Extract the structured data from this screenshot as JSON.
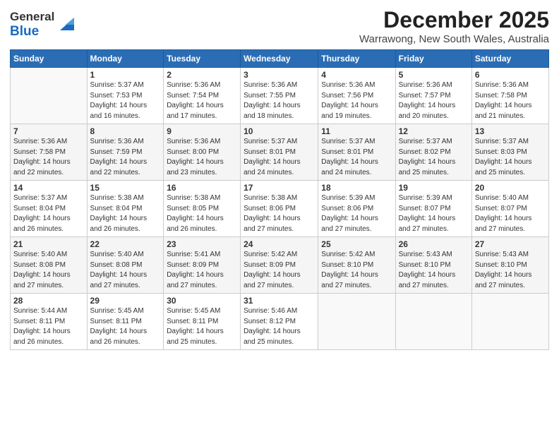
{
  "header": {
    "logo_general": "General",
    "logo_blue": "Blue",
    "month": "December 2025",
    "location": "Warrawong, New South Wales, Australia"
  },
  "weekdays": [
    "Sunday",
    "Monday",
    "Tuesday",
    "Wednesday",
    "Thursday",
    "Friday",
    "Saturday"
  ],
  "weeks": [
    [
      {
        "day": "",
        "sunrise": "",
        "sunset": "",
        "daylight": ""
      },
      {
        "day": "1",
        "sunrise": "Sunrise: 5:37 AM",
        "sunset": "Sunset: 7:53 PM",
        "daylight": "Daylight: 14 hours and 16 minutes."
      },
      {
        "day": "2",
        "sunrise": "Sunrise: 5:36 AM",
        "sunset": "Sunset: 7:54 PM",
        "daylight": "Daylight: 14 hours and 17 minutes."
      },
      {
        "day": "3",
        "sunrise": "Sunrise: 5:36 AM",
        "sunset": "Sunset: 7:55 PM",
        "daylight": "Daylight: 14 hours and 18 minutes."
      },
      {
        "day": "4",
        "sunrise": "Sunrise: 5:36 AM",
        "sunset": "Sunset: 7:56 PM",
        "daylight": "Daylight: 14 hours and 19 minutes."
      },
      {
        "day": "5",
        "sunrise": "Sunrise: 5:36 AM",
        "sunset": "Sunset: 7:57 PM",
        "daylight": "Daylight: 14 hours and 20 minutes."
      },
      {
        "day": "6",
        "sunrise": "Sunrise: 5:36 AM",
        "sunset": "Sunset: 7:58 PM",
        "daylight": "Daylight: 14 hours and 21 minutes."
      }
    ],
    [
      {
        "day": "7",
        "sunrise": "Sunrise: 5:36 AM",
        "sunset": "Sunset: 7:58 PM",
        "daylight": "Daylight: 14 hours and 22 minutes."
      },
      {
        "day": "8",
        "sunrise": "Sunrise: 5:36 AM",
        "sunset": "Sunset: 7:59 PM",
        "daylight": "Daylight: 14 hours and 22 minutes."
      },
      {
        "day": "9",
        "sunrise": "Sunrise: 5:36 AM",
        "sunset": "Sunset: 8:00 PM",
        "daylight": "Daylight: 14 hours and 23 minutes."
      },
      {
        "day": "10",
        "sunrise": "Sunrise: 5:37 AM",
        "sunset": "Sunset: 8:01 PM",
        "daylight": "Daylight: 14 hours and 24 minutes."
      },
      {
        "day": "11",
        "sunrise": "Sunrise: 5:37 AM",
        "sunset": "Sunset: 8:01 PM",
        "daylight": "Daylight: 14 hours and 24 minutes."
      },
      {
        "day": "12",
        "sunrise": "Sunrise: 5:37 AM",
        "sunset": "Sunset: 8:02 PM",
        "daylight": "Daylight: 14 hours and 25 minutes."
      },
      {
        "day": "13",
        "sunrise": "Sunrise: 5:37 AM",
        "sunset": "Sunset: 8:03 PM",
        "daylight": "Daylight: 14 hours and 25 minutes."
      }
    ],
    [
      {
        "day": "14",
        "sunrise": "Sunrise: 5:37 AM",
        "sunset": "Sunset: 8:04 PM",
        "daylight": "Daylight: 14 hours and 26 minutes."
      },
      {
        "day": "15",
        "sunrise": "Sunrise: 5:38 AM",
        "sunset": "Sunset: 8:04 PM",
        "daylight": "Daylight: 14 hours and 26 minutes."
      },
      {
        "day": "16",
        "sunrise": "Sunrise: 5:38 AM",
        "sunset": "Sunset: 8:05 PM",
        "daylight": "Daylight: 14 hours and 26 minutes."
      },
      {
        "day": "17",
        "sunrise": "Sunrise: 5:38 AM",
        "sunset": "Sunset: 8:06 PM",
        "daylight": "Daylight: 14 hours and 27 minutes."
      },
      {
        "day": "18",
        "sunrise": "Sunrise: 5:39 AM",
        "sunset": "Sunset: 8:06 PM",
        "daylight": "Daylight: 14 hours and 27 minutes."
      },
      {
        "day": "19",
        "sunrise": "Sunrise: 5:39 AM",
        "sunset": "Sunset: 8:07 PM",
        "daylight": "Daylight: 14 hours and 27 minutes."
      },
      {
        "day": "20",
        "sunrise": "Sunrise: 5:40 AM",
        "sunset": "Sunset: 8:07 PM",
        "daylight": "Daylight: 14 hours and 27 minutes."
      }
    ],
    [
      {
        "day": "21",
        "sunrise": "Sunrise: 5:40 AM",
        "sunset": "Sunset: 8:08 PM",
        "daylight": "Daylight: 14 hours and 27 minutes."
      },
      {
        "day": "22",
        "sunrise": "Sunrise: 5:40 AM",
        "sunset": "Sunset: 8:08 PM",
        "daylight": "Daylight: 14 hours and 27 minutes."
      },
      {
        "day": "23",
        "sunrise": "Sunrise: 5:41 AM",
        "sunset": "Sunset: 8:09 PM",
        "daylight": "Daylight: 14 hours and 27 minutes."
      },
      {
        "day": "24",
        "sunrise": "Sunrise: 5:42 AM",
        "sunset": "Sunset: 8:09 PM",
        "daylight": "Daylight: 14 hours and 27 minutes."
      },
      {
        "day": "25",
        "sunrise": "Sunrise: 5:42 AM",
        "sunset": "Sunset: 8:10 PM",
        "daylight": "Daylight: 14 hours and 27 minutes."
      },
      {
        "day": "26",
        "sunrise": "Sunrise: 5:43 AM",
        "sunset": "Sunset: 8:10 PM",
        "daylight": "Daylight: 14 hours and 27 minutes."
      },
      {
        "day": "27",
        "sunrise": "Sunrise: 5:43 AM",
        "sunset": "Sunset: 8:10 PM",
        "daylight": "Daylight: 14 hours and 27 minutes."
      }
    ],
    [
      {
        "day": "28",
        "sunrise": "Sunrise: 5:44 AM",
        "sunset": "Sunset: 8:11 PM",
        "daylight": "Daylight: 14 hours and 26 minutes."
      },
      {
        "day": "29",
        "sunrise": "Sunrise: 5:45 AM",
        "sunset": "Sunset: 8:11 PM",
        "daylight": "Daylight: 14 hours and 26 minutes."
      },
      {
        "day": "30",
        "sunrise": "Sunrise: 5:45 AM",
        "sunset": "Sunset: 8:11 PM",
        "daylight": "Daylight: 14 hours and 25 minutes."
      },
      {
        "day": "31",
        "sunrise": "Sunrise: 5:46 AM",
        "sunset": "Sunset: 8:12 PM",
        "daylight": "Daylight: 14 hours and 25 minutes."
      },
      {
        "day": "",
        "sunrise": "",
        "sunset": "",
        "daylight": ""
      },
      {
        "day": "",
        "sunrise": "",
        "sunset": "",
        "daylight": ""
      },
      {
        "day": "",
        "sunrise": "",
        "sunset": "",
        "daylight": ""
      }
    ]
  ]
}
